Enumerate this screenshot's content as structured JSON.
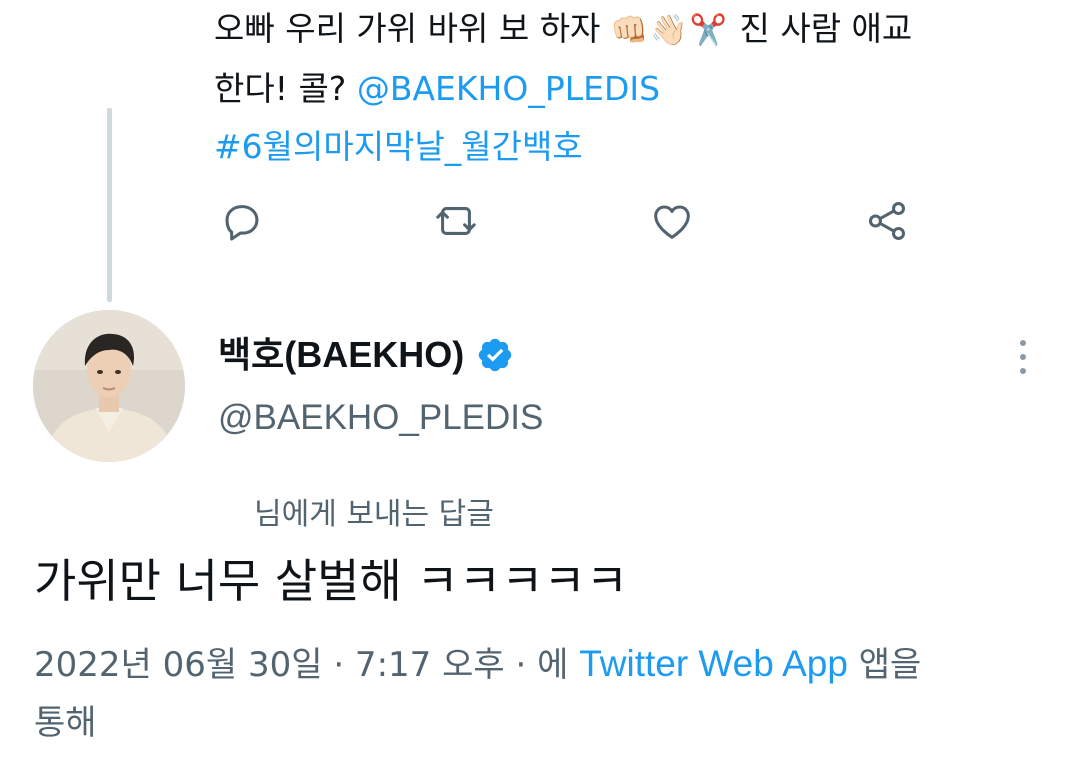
{
  "parent_tweet": {
    "line1_text": "오빠 우리 가위 바위 보 하자",
    "line1_emojis": "👊🏻👋🏻✂️",
    "line1_tail": "진 사람 애교",
    "line2_text": "한다! 콜?",
    "mention": "@BAEKHO_PLEDIS",
    "hashtag": "#6월의마지막날_월간백호"
  },
  "actions": [
    {
      "name": "reply",
      "icon": "reply-icon"
    },
    {
      "name": "retweet",
      "icon": "retweet-icon"
    },
    {
      "name": "like",
      "icon": "heart-icon"
    },
    {
      "name": "share",
      "icon": "share-icon"
    }
  ],
  "reply_tweet": {
    "display_name": "백호(BAEKHO)",
    "verified": true,
    "handle": "@BAEKHO_PLEDIS",
    "reply_to_text": "님에게 보내는 답글",
    "text": "가위만 너무 살벌해 ㅋㅋㅋㅋㅋ",
    "timestamp": "2022년 06월 30일 · 7:17 오후 ·",
    "via_prefix": "에",
    "app_name": "Twitter Web App",
    "via_suffix": "앱을",
    "via_line2": "통해"
  },
  "colors": {
    "link": "#1d9bf0",
    "secondary_text": "#536471",
    "primary_text": "#0f1419",
    "thread_line": "#cfd9de"
  }
}
